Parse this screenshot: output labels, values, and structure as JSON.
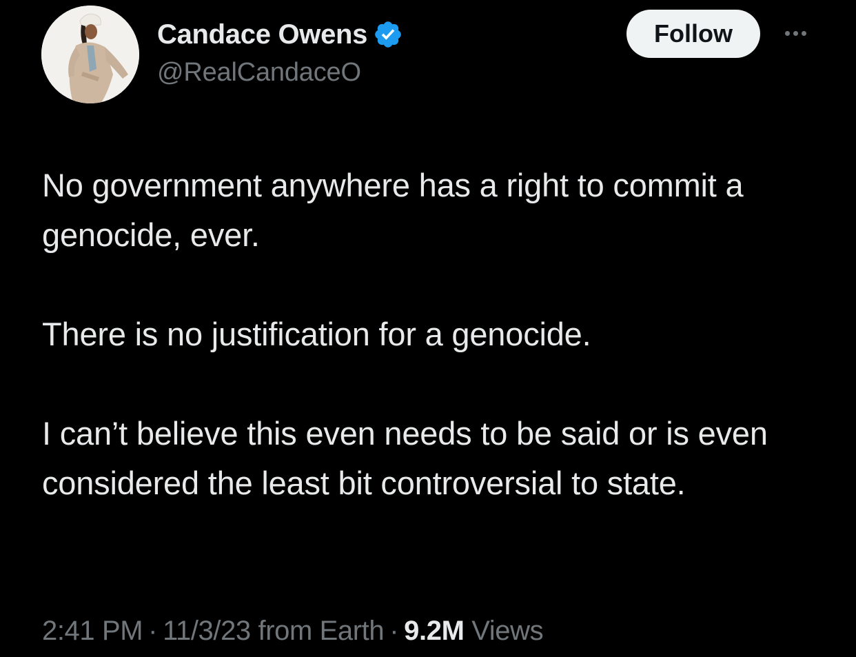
{
  "author": {
    "display_name": "Candace Owens",
    "handle": "@RealCandaceO",
    "verified_icon": "verified-badge-icon",
    "verified_color": "#1d9bf0"
  },
  "actions": {
    "follow_label": "Follow",
    "more_icon": "more-horizontal-icon"
  },
  "tweet": {
    "paragraphs": [
      "No government anywhere has a right to commit a genocide, ever.",
      "There is no justification for a genocide.",
      "I can’t believe this even needs to be said or is even considered the least bit controversial to state."
    ]
  },
  "meta": {
    "time": "2:41 PM",
    "date": "11/3/23",
    "source": "from Earth",
    "separator": "·",
    "views_count": "9.2M",
    "views_label": "Views"
  },
  "colors": {
    "background": "#000000",
    "primary_text": "#e7e9ea",
    "secondary_text": "#71767b",
    "follow_bg": "#eff3f4",
    "follow_text": "#0f1419"
  }
}
